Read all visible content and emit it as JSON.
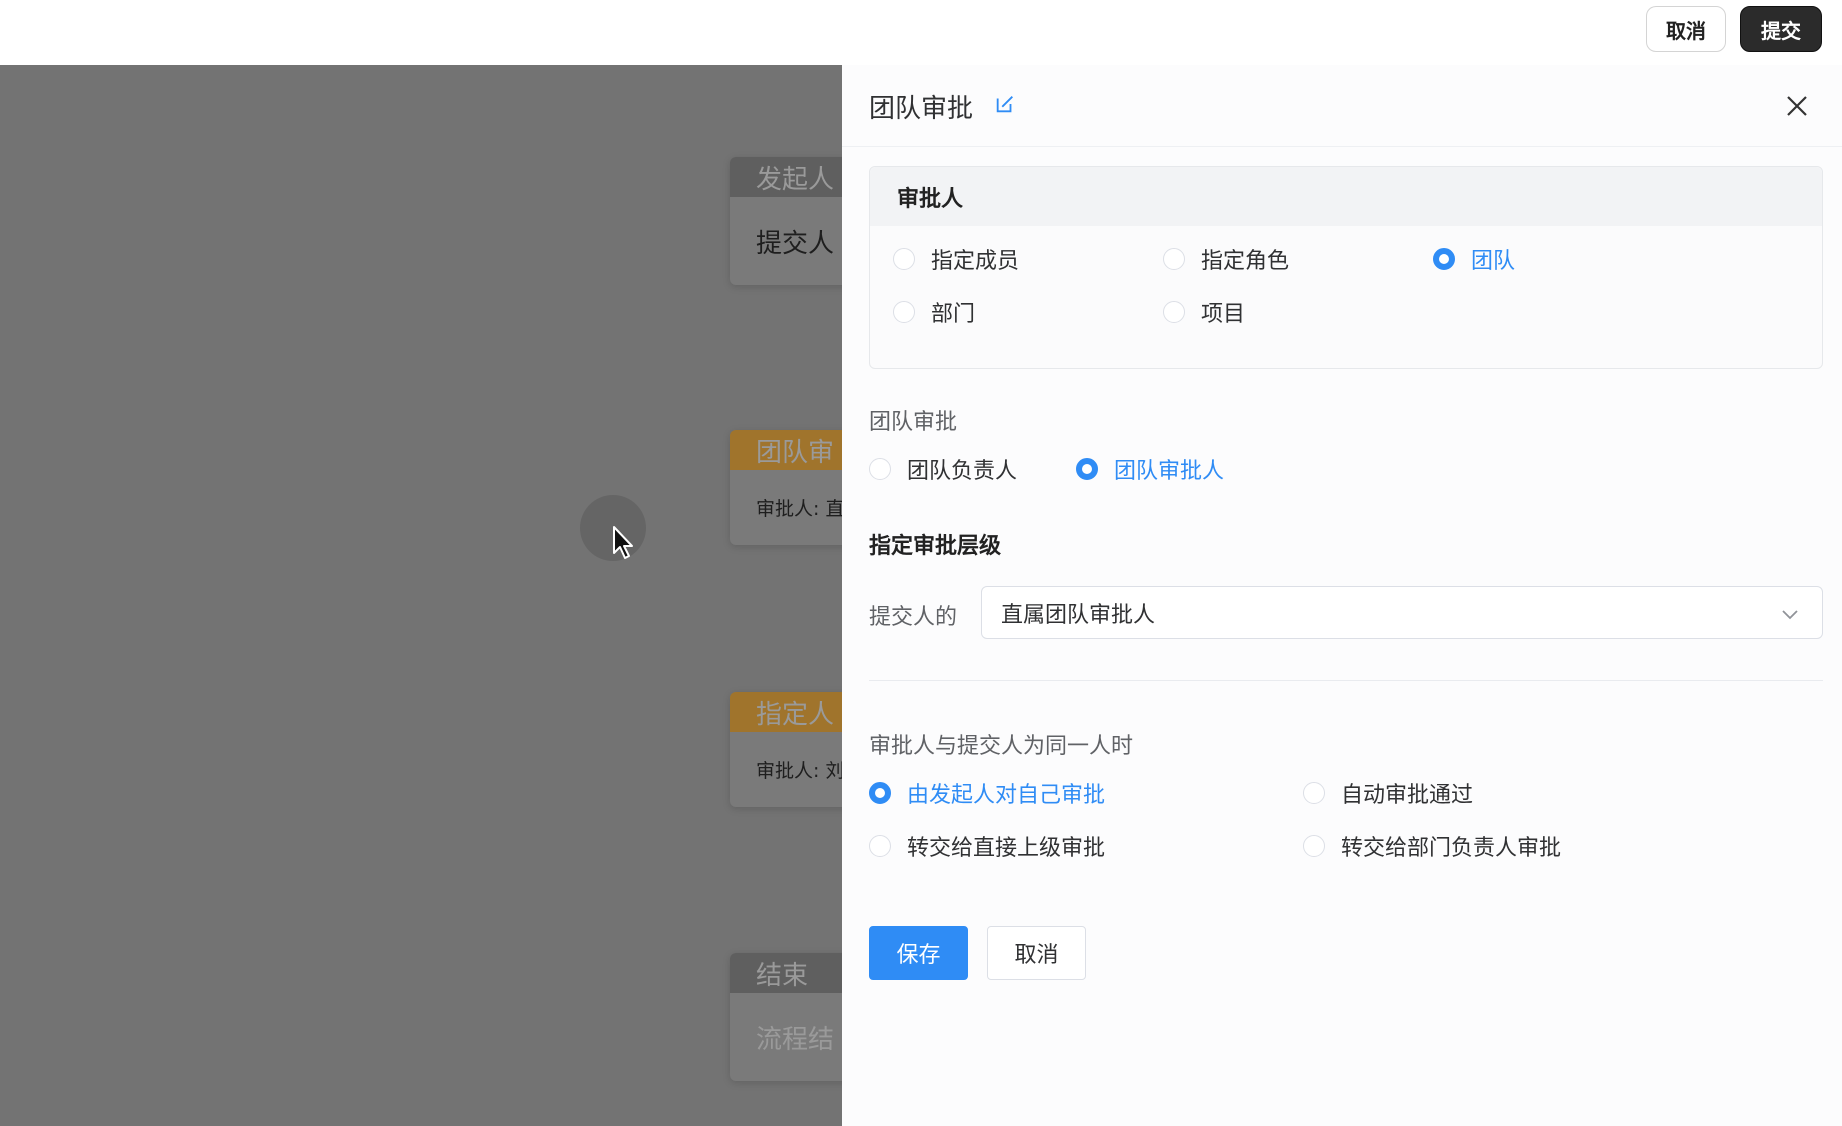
{
  "topbar": {
    "cancel_label": "取消",
    "submit_label": "提交"
  },
  "flow": {
    "nodes": [
      {
        "title": "发起人",
        "body": "提交人"
      },
      {
        "title": "团队审",
        "body": "审批人: 直"
      },
      {
        "title": "指定人",
        "body": "审批人: 刘"
      },
      {
        "title": "结束",
        "body": "流程结"
      }
    ]
  },
  "drawer": {
    "title": "团队审批",
    "approver": {
      "heading": "审批人",
      "options": [
        "指定成员",
        "指定角色",
        "团队",
        "部门",
        "项目"
      ],
      "selected": "团队"
    },
    "team_approval": {
      "label": "团队审批",
      "options": [
        "团队负责人",
        "团队审批人"
      ],
      "selected": "团队审批人"
    },
    "level": {
      "heading": "指定审批层级",
      "prefix": "提交人的",
      "value": "直属团队审批人"
    },
    "same_person": {
      "label": "审批人与提交人为同一人时",
      "options": [
        "由发起人对自己审批",
        "自动审批通过",
        "转交给直接上级审批",
        "转交给部门负责人审批"
      ],
      "selected": "由发起人对自己审批"
    },
    "save_label": "保存",
    "cancel_label": "取消"
  },
  "colors": {
    "primary": "#2f8cf5",
    "overlay": "#737373",
    "node_orange": "#a0742c"
  }
}
